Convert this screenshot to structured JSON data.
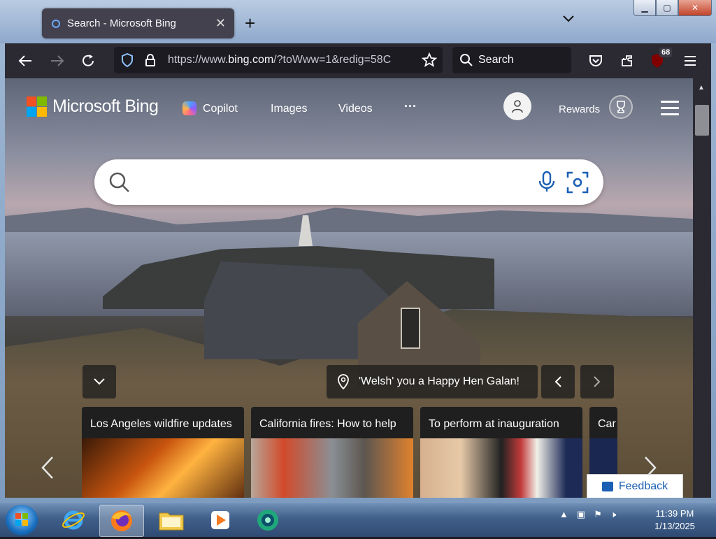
{
  "browser": {
    "tab_title": "Search - Microsoft Bing",
    "url": "https://www.bing.com/?toWww=1&redig=58C",
    "url_prefix": "https://www.",
    "url_domain": "bing.com",
    "url_rest": "/?toWww=1&redig=58C",
    "search_placeholder": "Search",
    "extension_badge": "68"
  },
  "bing": {
    "brand": "Microsoft Bing",
    "nav": {
      "copilot": "Copilot",
      "images": "Images",
      "videos": "Videos",
      "more": "···"
    },
    "rewards_label": "Rewards",
    "image_caption": "'Welsh' you a Happy Hen Galan!",
    "cards": [
      {
        "title": "Los Angeles wildfire updates"
      },
      {
        "title": "California fires: How to help"
      },
      {
        "title": "To perform at inauguration"
      },
      {
        "title": "Car"
      }
    ],
    "feedback_label": "Feedback"
  },
  "taskbar": {
    "time": "11:39 PM",
    "date": "1/13/2025"
  },
  "colors": {
    "bing_blue": "#1a5fb4",
    "firefox_toolbar": "#2b2a33"
  },
  "icons": [
    "search-icon",
    "microphone-icon",
    "visual-search-icon",
    "location-pin-icon",
    "chevron-left-icon",
    "chevron-right-icon",
    "chevron-down-icon",
    "user-icon",
    "trophy-icon",
    "hamburger-icon",
    "shield-icon",
    "lock-icon",
    "star-icon",
    "pocket-icon",
    "extensions-icon",
    "ublock-icon",
    "menu-icon"
  ]
}
